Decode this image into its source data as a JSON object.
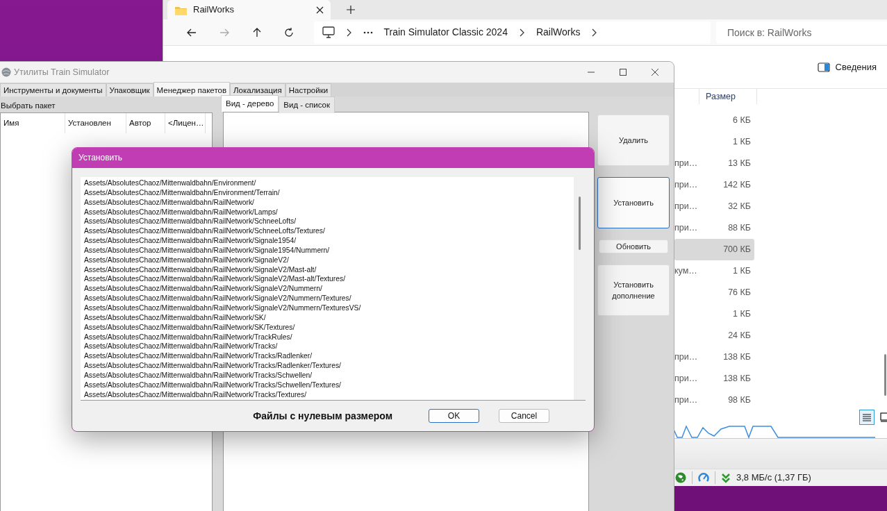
{
  "explorer": {
    "tab_title": "RailWorks",
    "breadcrumb": [
      "Train Simulator Classic 2024",
      "RailWorks"
    ],
    "search": {
      "placeholder": "Поиск в: RailWorks"
    },
    "details_button": "Сведения",
    "columns": [
      "Размер"
    ],
    "rows": [
      {
        "size": "6 КБ",
        "selected": false
      },
      {
        "size": "1 КБ",
        "selected": false
      },
      {
        "column_2": "при…",
        "size": "13 КБ",
        "selected": false
      },
      {
        "column_2": "при…",
        "size": "142 КБ",
        "selected": false
      },
      {
        "column_2": "при…",
        "size": "32 КБ",
        "selected": false
      },
      {
        "column_2": "при…",
        "size": "88 КБ",
        "selected": false
      },
      {
        "size": "700 КБ",
        "selected": true
      },
      {
        "column_2": "кум…",
        "size": "1 КБ",
        "selected": false
      },
      {
        "size": "76 КБ",
        "selected": false
      },
      {
        "size": "1 КБ",
        "selected": false
      },
      {
        "size": "24 КБ",
        "selected": false
      },
      {
        "column_2": "при…",
        "size": "138 КБ",
        "selected": false
      },
      {
        "column_2": "при…",
        "size": "138 КБ",
        "selected": false
      },
      {
        "column_2": "при…",
        "size": "98 КБ",
        "selected": false
      }
    ],
    "view_modes": [
      {
        "kind": "details",
        "selected": true
      },
      {
        "kind": "tiles",
        "selected": false
      }
    ]
  },
  "background_app": {
    "transfer_rate": "3,8 МБ/с (1,37 ГБ)"
  },
  "utility": {
    "title": "Утилиты Train Simulator",
    "tabs": [
      {
        "label": "Инструменты и документы",
        "selected": false
      },
      {
        "label": "Упаковщик",
        "selected": false
      },
      {
        "label": "Менеджер пакетов",
        "selected": true
      },
      {
        "label": "Локализация",
        "selected": false
      },
      {
        "label": "Настройки",
        "selected": false
      }
    ],
    "package_panel": {
      "title": "Выбрать пакет",
      "columns": [
        "Имя",
        "Установлен",
        "Автор",
        "<Лицен…"
      ]
    },
    "view_tabs": [
      {
        "label": "Вид - дерево",
        "selected": true
      },
      {
        "label": "Вид - список",
        "selected": false
      }
    ],
    "buttons": [
      {
        "label": "Удалить",
        "kind": "large",
        "focused": false
      },
      {
        "label": "Установить",
        "kind": "large",
        "focused": true
      },
      {
        "label": "Обновить",
        "kind": "small",
        "focused": false
      },
      {
        "label": "Установить дополнение",
        "kind": "large",
        "focused": false
      }
    ]
  },
  "dialog": {
    "title": "Установить",
    "lines": [
      "Assets/AbsolutesChaoz/Mittenwaldbahn/Environment/",
      "Assets/AbsolutesChaoz/Mittenwaldbahn/Environment/Terrain/",
      "Assets/AbsolutesChaoz/Mittenwaldbahn/RailNetwork/",
      "Assets/AbsolutesChaoz/Mittenwaldbahn/RailNetwork/Lamps/",
      "Assets/AbsolutesChaoz/Mittenwaldbahn/RailNetwork/SchneeLofts/",
      "Assets/AbsolutesChaoz/Mittenwaldbahn/RailNetwork/SchneeLofts/Textures/",
      "Assets/AbsolutesChaoz/Mittenwaldbahn/RailNetwork/Signale1954/",
      "Assets/AbsolutesChaoz/Mittenwaldbahn/RailNetwork/Signale1954/Nummern/",
      "Assets/AbsolutesChaoz/Mittenwaldbahn/RailNetwork/SignaleV2/",
      "Assets/AbsolutesChaoz/Mittenwaldbahn/RailNetwork/SignaleV2/Mast-alt/",
      "Assets/AbsolutesChaoz/Mittenwaldbahn/RailNetwork/SignaleV2/Mast-alt/Textures/",
      "Assets/AbsolutesChaoz/Mittenwaldbahn/RailNetwork/SignaleV2/Nummern/",
      "Assets/AbsolutesChaoz/Mittenwaldbahn/RailNetwork/SignaleV2/Nummern/Textures/",
      "Assets/AbsolutesChaoz/Mittenwaldbahn/RailNetwork/SignaleV2/Nummern/TexturesVS/",
      "Assets/AbsolutesChaoz/Mittenwaldbahn/RailNetwork/SK/",
      "Assets/AbsolutesChaoz/Mittenwaldbahn/RailNetwork/SK/Textures/",
      "Assets/AbsolutesChaoz/Mittenwaldbahn/RailNetwork/TrackRules/",
      "Assets/AbsolutesChaoz/Mittenwaldbahn/RailNetwork/Tracks/",
      "Assets/AbsolutesChaoz/Mittenwaldbahn/RailNetwork/Tracks/Radlenker/",
      "Assets/AbsolutesChaoz/Mittenwaldbahn/RailNetwork/Tracks/Radlenker/Textures/",
      "Assets/AbsolutesChaoz/Mittenwaldbahn/RailNetwork/Tracks/Schwellen/",
      "Assets/AbsolutesChaoz/Mittenwaldbahn/RailNetwork/Tracks/Schwellen/Textures/",
      "Assets/AbsolutesChaoz/Mittenwaldbahn/RailNetwork/Tracks/Textures/"
    ],
    "label": "Файлы с нулевым размером",
    "buttons": [
      {
        "label": "OK",
        "default": true
      },
      {
        "label": "Cancel",
        "default": false
      }
    ]
  }
}
